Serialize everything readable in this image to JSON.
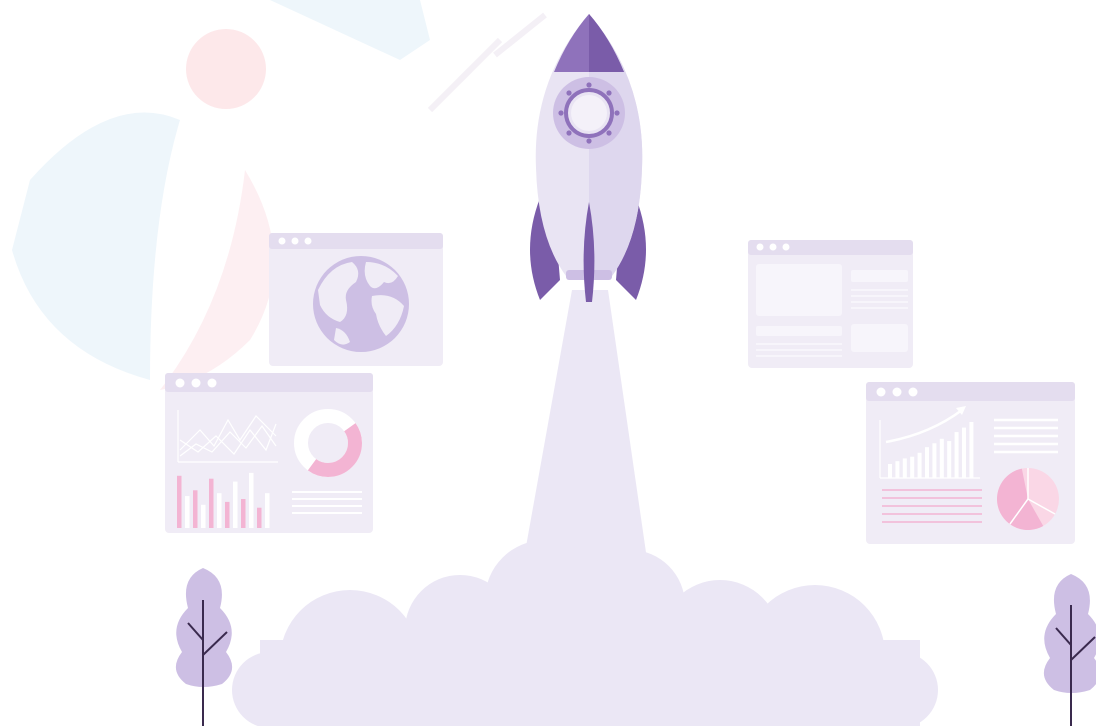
{
  "colors": {
    "purple_dark": "#7a5ca9",
    "purple_mid": "#8f72bb",
    "purple_light": "#cdbfe4",
    "lavender": "#ebe7f5",
    "window_body": "#f0ecf6",
    "window_title": "#e4ddef",
    "pink": "#f3b4d3",
    "pink_light": "#fad7e6",
    "watermark_red": "#fde8ea",
    "watermark_blue": "#eef6fb",
    "tree_trunk": "#3a2a4e"
  },
  "illustration": {
    "subject": "rocket-launch",
    "windows": [
      {
        "name": "globe-window",
        "icon": "globe-icon"
      },
      {
        "name": "layout-window",
        "icon": "layout-icon"
      },
      {
        "name": "analytics-window-left",
        "icon": "chart-icon"
      },
      {
        "name": "analytics-window-right",
        "icon": "chart-icon"
      }
    ],
    "left_window_bars": [
      0.9,
      0.55,
      0.65,
      0.4,
      0.85,
      0.6,
      0.45,
      0.8,
      0.5,
      0.95,
      0.35,
      0.6
    ],
    "right_window_bars": [
      0.25,
      0.3,
      0.35,
      0.38,
      0.45,
      0.55,
      0.62,
      0.7,
      0.66,
      0.82,
      0.9,
      1.0
    ],
    "left_donut_fraction": 0.45,
    "right_pie_fraction": 0.55
  }
}
